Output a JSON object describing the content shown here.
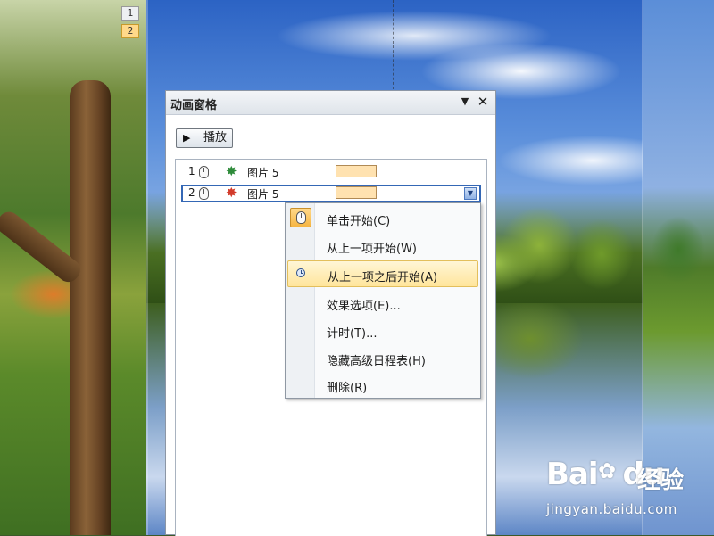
{
  "slide": {
    "animation_badges": [
      "1",
      "2"
    ]
  },
  "pane": {
    "title": "动画窗格",
    "menu_glyph": "▼",
    "close_glyph": "✕",
    "play_button": {
      "icon": "play-icon",
      "label": "播放"
    }
  },
  "animation_list": [
    {
      "number": "1",
      "trigger_icon": "mouse-icon",
      "effect_icon": "green-star-icon",
      "effect_color": "#2e8b3a",
      "name": "图片 5",
      "bar_color": "#ffe2b0",
      "selected": false
    },
    {
      "number": "2",
      "trigger_icon": "mouse-icon",
      "effect_icon": "red-star-icon",
      "effect_color": "#d23a2a",
      "name": "图片 5",
      "bar_color": "#ffe2b0",
      "selected": true
    }
  ],
  "context_menu": {
    "items": [
      {
        "label": "单击开始(C)",
        "icon": "mouse-icon"
      },
      {
        "label": "从上一项开始(W)",
        "icon": ""
      },
      {
        "label": "从上一项之后开始(A)",
        "icon": "clock-icon",
        "highlighted": true
      },
      {
        "label": "效果选项(E)...",
        "icon": ""
      },
      {
        "label": "计时(T)...",
        "icon": ""
      },
      {
        "label": "隐藏高级日程表(H)",
        "icon": ""
      },
      {
        "label": "删除(R)",
        "icon": ""
      }
    ]
  },
  "watermark": {
    "logo": "Bai",
    "logo_suffix": "du",
    "product": "经验",
    "url": "jingyan.baidu.com"
  },
  "colors": {
    "selection_border": "#3467b5",
    "menu_highlight": "#ffe59c",
    "timing_bar": "#ffe2b0"
  }
}
